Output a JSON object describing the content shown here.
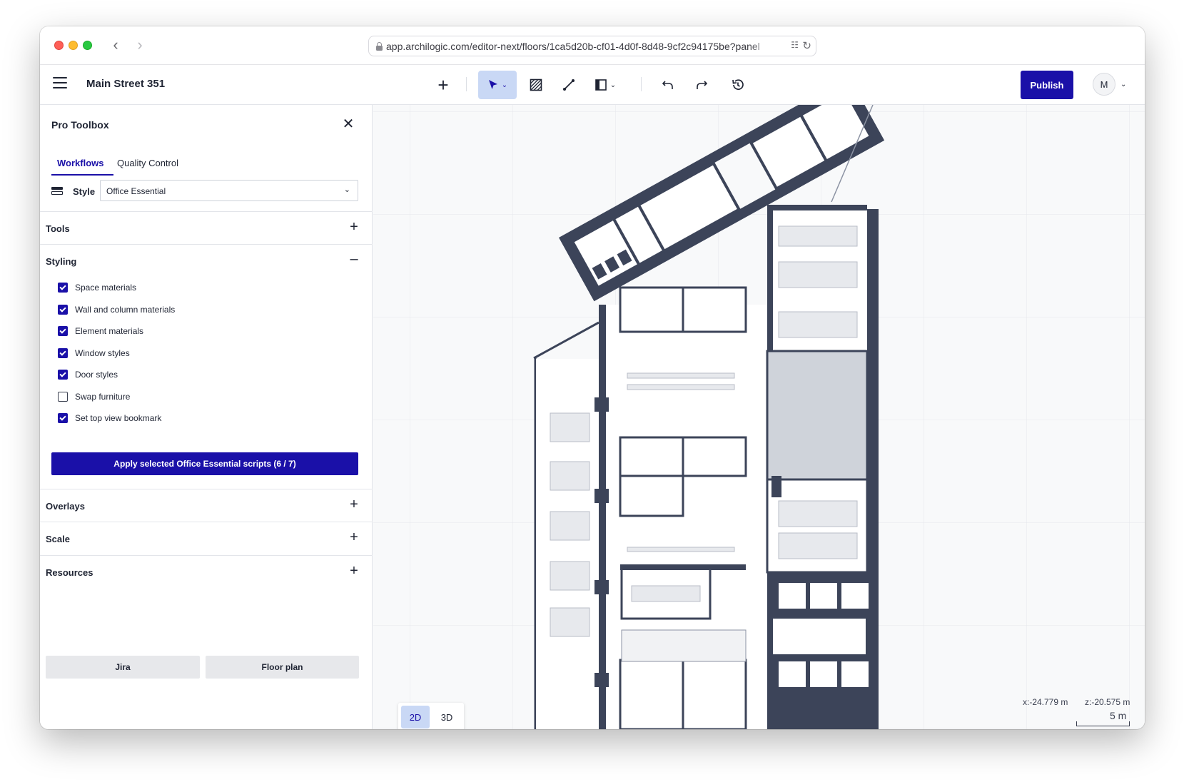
{
  "browser": {
    "url": "app.archilogic.com/editor-next/floors/1ca5d20b-cf01-4d0f-8d48-9cf2c94175be?panel"
  },
  "header": {
    "title": "Main Street 351",
    "publish_label": "Publish",
    "avatar_initial": "M"
  },
  "sidebar": {
    "title": "Pro Toolbox",
    "tabs": [
      "Workflows",
      "Quality Control"
    ],
    "style_label": "Style",
    "style_value": "Office Essential",
    "sections": {
      "tools": "Tools",
      "styling": "Styling",
      "overlays": "Overlays",
      "scale": "Scale",
      "resources": "Resources"
    },
    "styling_options": [
      {
        "label": "Space materials",
        "checked": true
      },
      {
        "label": "Wall and column materials",
        "checked": true
      },
      {
        "label": "Element materials",
        "checked": true
      },
      {
        "label": "Window styles",
        "checked": true
      },
      {
        "label": "Door styles",
        "checked": true
      },
      {
        "label": "Swap furniture",
        "checked": false
      },
      {
        "label": "Set top view bookmark",
        "checked": true
      }
    ],
    "apply_label": "Apply selected Office Essential scripts (6 / 7)",
    "footer": {
      "jira": "Jira",
      "floor_plan": "Floor plan"
    }
  },
  "canvas": {
    "view_modes": [
      "2D",
      "3D"
    ],
    "active_view": "2D",
    "coord_x": "x:-24.779 m",
    "coord_z": "z:-20.575 m",
    "scale_label": "5 m"
  },
  "colors": {
    "accent": "#1a10a8",
    "accent_soft": "#c9d8f5",
    "wall": "#3c4459",
    "core": "#cfd3da"
  }
}
